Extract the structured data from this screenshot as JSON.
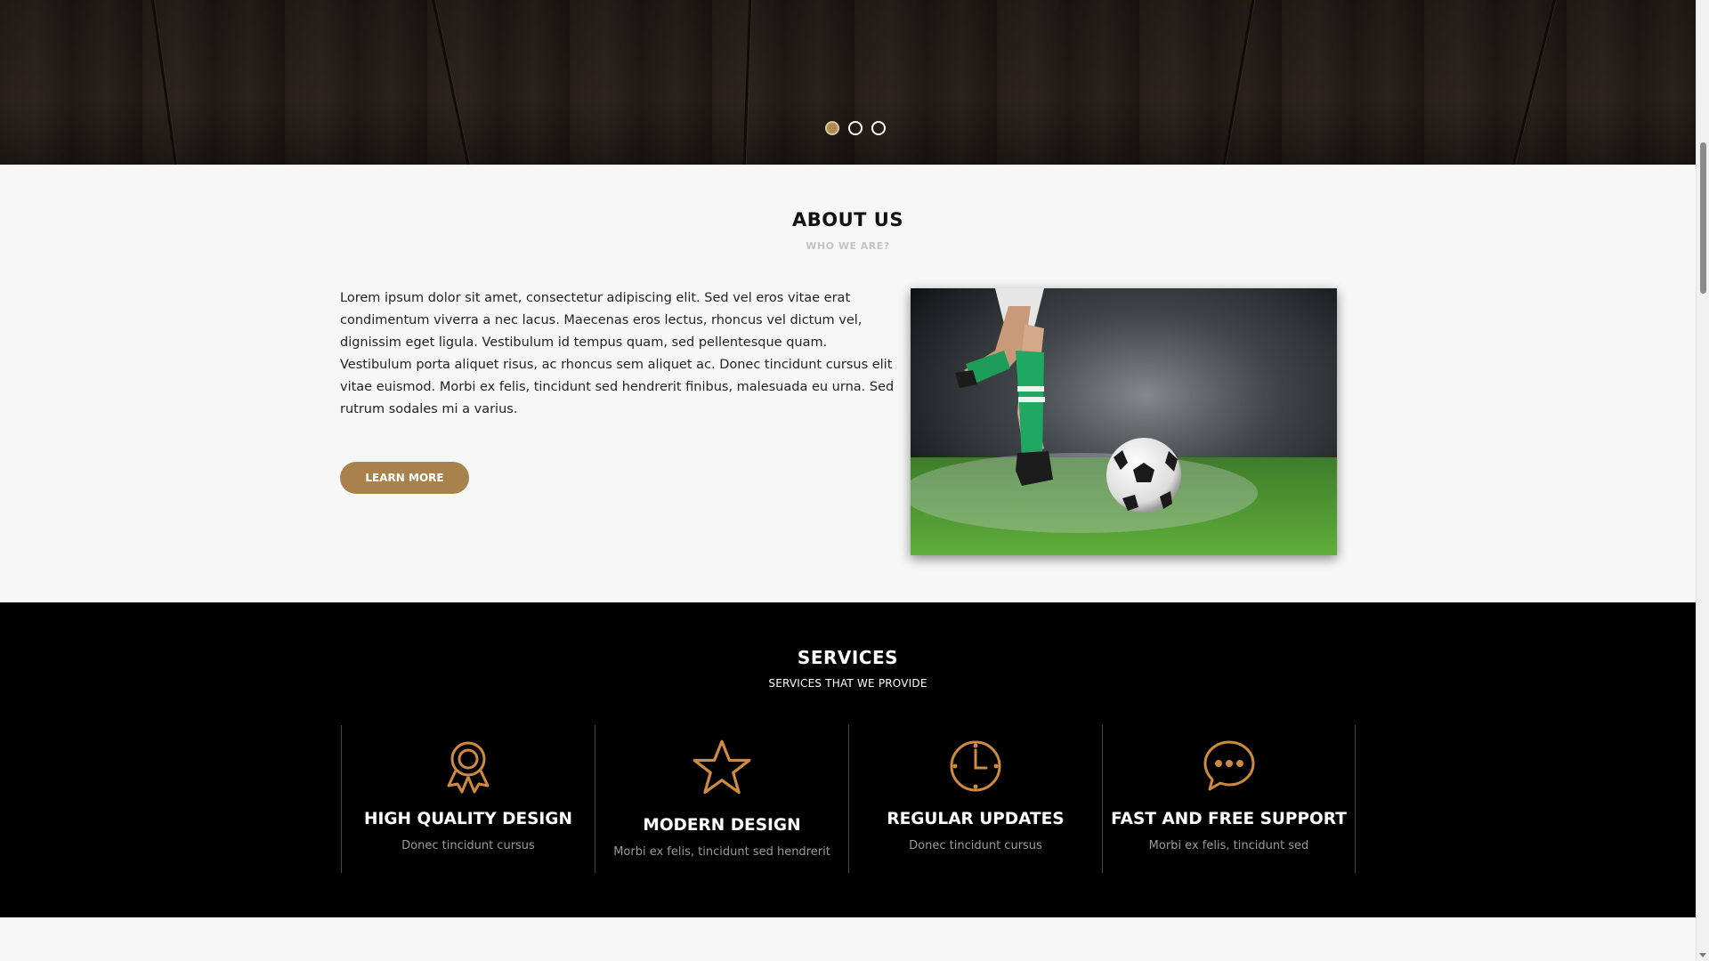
{
  "hero": {
    "slides": [
      "slide-1",
      "slide-2",
      "slide-3"
    ],
    "active_slide": 1
  },
  "about": {
    "title": "ABOUT US",
    "subtitle": "WHO WE ARE?",
    "body": "Lorem ipsum dolor sit amet, consectetur adipiscing elit. Sed vel eros vitae erat condimentum viverra a nec lacus. Maecenas eros lectus, rhoncus vel dictum vel, dignissim eget ligula. Vestibulum id tempus quam, sed pellentesque quam. Vestibulum porta aliquet risus, ac rhoncus sem aliquet ac. Donec tincidunt cursus elit vitae euismod. Morbi ex felis, tincidunt sed hendrerit finibus, malesuada eu urna. Sed rutrum sodales mi a varius.",
    "button_label": "LEARN MORE"
  },
  "services": {
    "title": "SERVICES",
    "subtitle": "SERVICES THAT WE PROVIDE",
    "items": [
      {
        "icon": "award-ribbon-icon",
        "title": "HIGH QUALITY DESIGN",
        "desc": "Donec tincidunt cursus"
      },
      {
        "icon": "star-icon",
        "title": "MODERN DESIGN",
        "desc": "Morbi ex felis, tincidunt sed hendrerit"
      },
      {
        "icon": "clock-icon",
        "title": "REGULAR UPDATES",
        "desc": "Donec tincidunt cursus"
      },
      {
        "icon": "chat-bubble-icon",
        "title": "FAST AND FREE SUPPORT",
        "desc": "Morbi ex felis, tincidunt sed"
      }
    ]
  },
  "colors": {
    "accent": "#a9814d",
    "services_bg": "#000000",
    "about_bg": "#f7f7f7"
  }
}
